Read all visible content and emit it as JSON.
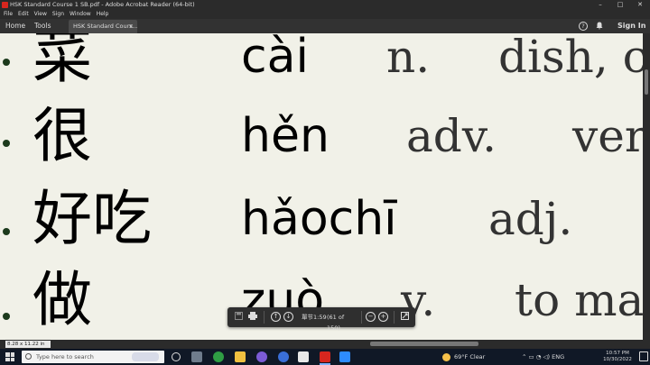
{
  "window": {
    "title": "HSK Standard Course 1 SB.pdf - Adobe Acrobat Reader (64-bit)",
    "controls": [
      "–",
      "□",
      "✕"
    ]
  },
  "menu": [
    "File",
    "Edit",
    "View",
    "Sign",
    "Window",
    "Help"
  ],
  "tabs": {
    "home": "Home",
    "tools": "Tools",
    "document": "HSK Standard Cours...",
    "close": "×"
  },
  "toolbar": {
    "help": "?",
    "sign_in": "Sign In"
  },
  "vocab": [
    {
      "hanzi": "菜",
      "pinyin": "cài",
      "pos": "n.",
      "meaning": "dish, c"
    },
    {
      "hanzi": "很",
      "pinyin": "hěn",
      "pos": "adv.",
      "meaning": "ver"
    },
    {
      "hanzi": "好吃",
      "pinyin": "hǎochī",
      "pos": "adj.",
      "meaning": ""
    },
    {
      "hanzi": "做",
      "pinyin": "zuò",
      "pos": "v.",
      "meaning": "to ma"
    }
  ],
  "float_toolbar": {
    "page_label": "單节1:59",
    "page_count": "(61 of 150)",
    "up": "↑",
    "down": "↓",
    "zoom_out": "−",
    "zoom_in": "+"
  },
  "status": {
    "page_size": "8.28 x 11.22 in"
  },
  "taskbar": {
    "search_placeholder": "Type here to search",
    "weather_temp": "69°F",
    "weather_desc": "Clear",
    "language": "ENG",
    "time": "10:57 PM",
    "date": "10/30/2022"
  },
  "colors": {
    "page_bg": "#f1f1e8",
    "chrome_bg": "#2b2b2b",
    "taskbar_bg": "#101826",
    "acrobat_red": "#d7261e"
  }
}
